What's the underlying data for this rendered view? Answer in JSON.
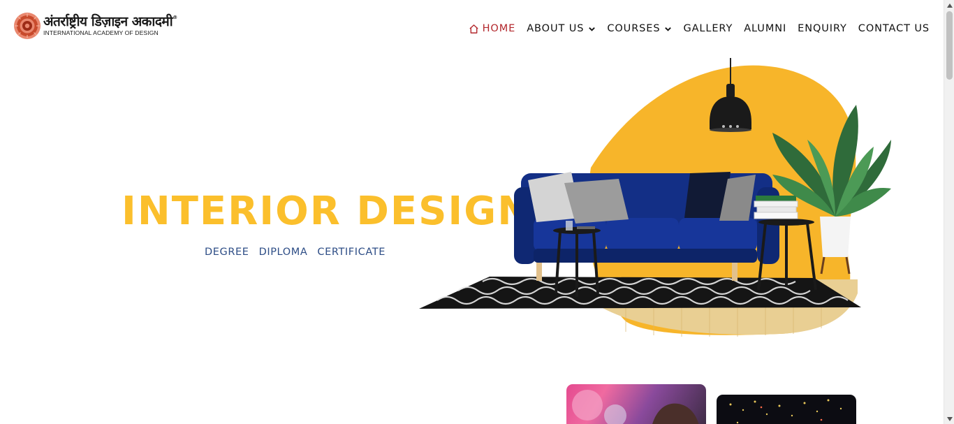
{
  "logo": {
    "hindi": "अंतर्राष्ट्रीय डिज़ाइन अकादमी",
    "registered": "®",
    "english": "INTERNATIONAL ACADEMY OF DESIGN"
  },
  "nav": {
    "items": [
      {
        "label": "HOME",
        "icon": "home-icon",
        "active": true
      },
      {
        "label": "ABOUT US",
        "icon": "chevron-down-icon"
      },
      {
        "label": "COURSES",
        "icon": "chevron-down-icon"
      },
      {
        "label": "GALLERY"
      },
      {
        "label": "ALUMNI"
      },
      {
        "label": "ENQUIRY"
      },
      {
        "label": "CONTACT US"
      }
    ]
  },
  "hero": {
    "title": "INTERIOR DESIGN",
    "subtitles": [
      "DEGREE",
      "DIPLOMA",
      "CERTIFICATE"
    ]
  },
  "colors": {
    "accent_yellow": "#fbbf2c",
    "nav_active": "#b3282d",
    "subtitle_blue": "#2d4d86",
    "sofa_blue": "#132f86"
  }
}
